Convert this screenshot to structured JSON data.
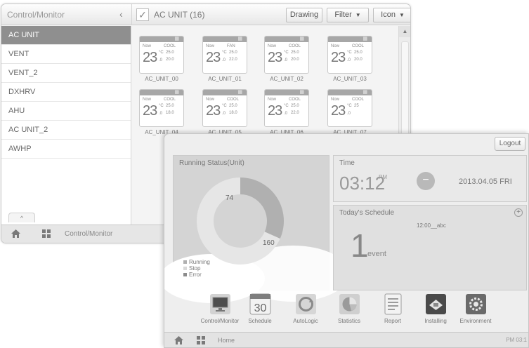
{
  "control_monitor": {
    "title": "Control/Monitor",
    "group_title": "AC UNIT (16)",
    "toolbar": {
      "drawing_label": "Drawing",
      "filter_label": "Filter",
      "icon_label": "Icon"
    },
    "sidebar": {
      "items": [
        {
          "label": "AC UNIT"
        },
        {
          "label": "VENT"
        },
        {
          "label": "VENT_2"
        },
        {
          "label": "DXHRV"
        },
        {
          "label": "AHU"
        },
        {
          "label": "AC UNIT_2"
        },
        {
          "label": "AWHP"
        }
      ],
      "active_index": 0
    },
    "units": [
      {
        "name": "AC_UNIT_00",
        "now": "Now",
        "mode": "COOL",
        "temp": "23",
        "unit": "°C",
        "decimal": ".0",
        "set": "25.0",
        "room": "20.0"
      },
      {
        "name": "AC_UNIT_01",
        "now": "Now",
        "mode": "FAN",
        "temp": "23",
        "unit": "°C",
        "decimal": ".0",
        "set": "25.0",
        "room": "22.0"
      },
      {
        "name": "AC_UNIT_02",
        "now": "Now",
        "mode": "COOL",
        "temp": "23",
        "unit": "°C",
        "decimal": ".0",
        "set": "25.0",
        "room": "20.0"
      },
      {
        "name": "AC_UNIT_03",
        "now": "Now",
        "mode": "COOL",
        "temp": "23",
        "unit": "°C",
        "decimal": ".0",
        "set": "25.0",
        "room": "20.0"
      },
      {
        "name": "AC_UNIT_04",
        "now": "Now",
        "mode": "COOL",
        "temp": "23",
        "unit": "°C",
        "decimal": ".0",
        "set": "25.0",
        "room": "18.0"
      },
      {
        "name": "AC_UNIT_05",
        "now": "Now",
        "mode": "COOL",
        "temp": "23",
        "unit": "°C",
        "decimal": ".0",
        "set": "25.0",
        "room": "18.0"
      },
      {
        "name": "AC_UNIT_06",
        "now": "Now",
        "mode": "COOL",
        "temp": "23",
        "unit": "°C",
        "decimal": ".0",
        "set": "25.0",
        "room": "22.0"
      },
      {
        "name": "AC_UNIT_07",
        "now": "Now",
        "mode": "COOL",
        "temp": "23",
        "unit": "°C",
        "decimal": ".0",
        "set": "25",
        "room": ""
      }
    ],
    "footer_breadcrumb": "Control/Monitor"
  },
  "home": {
    "logout_label": "Logout",
    "running": {
      "title": "Running Status(Unit)",
      "legend": [
        "Running",
        "Stop",
        "Error"
      ]
    },
    "chart_data": {
      "type": "pie",
      "categories": [
        "Running",
        "Stop",
        "Error"
      ],
      "values": [
        74,
        160,
        0
      ],
      "colors": [
        "#b0b0b0",
        "#e6e6e6",
        "#8c8c8c"
      ]
    },
    "time": {
      "title": "Time",
      "clock": "03:12",
      "ampm": "PM",
      "date": "2013.04.05 FRI"
    },
    "schedule": {
      "title": "Today's Schedule",
      "entry": "12:00__abc",
      "count": "1",
      "unit": "event"
    },
    "dock": [
      {
        "label": "Control/Monitor",
        "icon": "monitor-icon"
      },
      {
        "label": "Schedule",
        "icon": "calendar-icon"
      },
      {
        "label": "AutoLogic",
        "icon": "autologic-icon"
      },
      {
        "label": "Statistics",
        "icon": "statistics-icon"
      },
      {
        "label": "Report",
        "icon": "report-icon"
      },
      {
        "label": "Installing",
        "icon": "installing-icon"
      },
      {
        "label": "Environment",
        "icon": "environment-icon"
      }
    ],
    "schedule_day": "30",
    "footer_breadcrumb": "Home",
    "footer_clock": "PM 03:1"
  }
}
